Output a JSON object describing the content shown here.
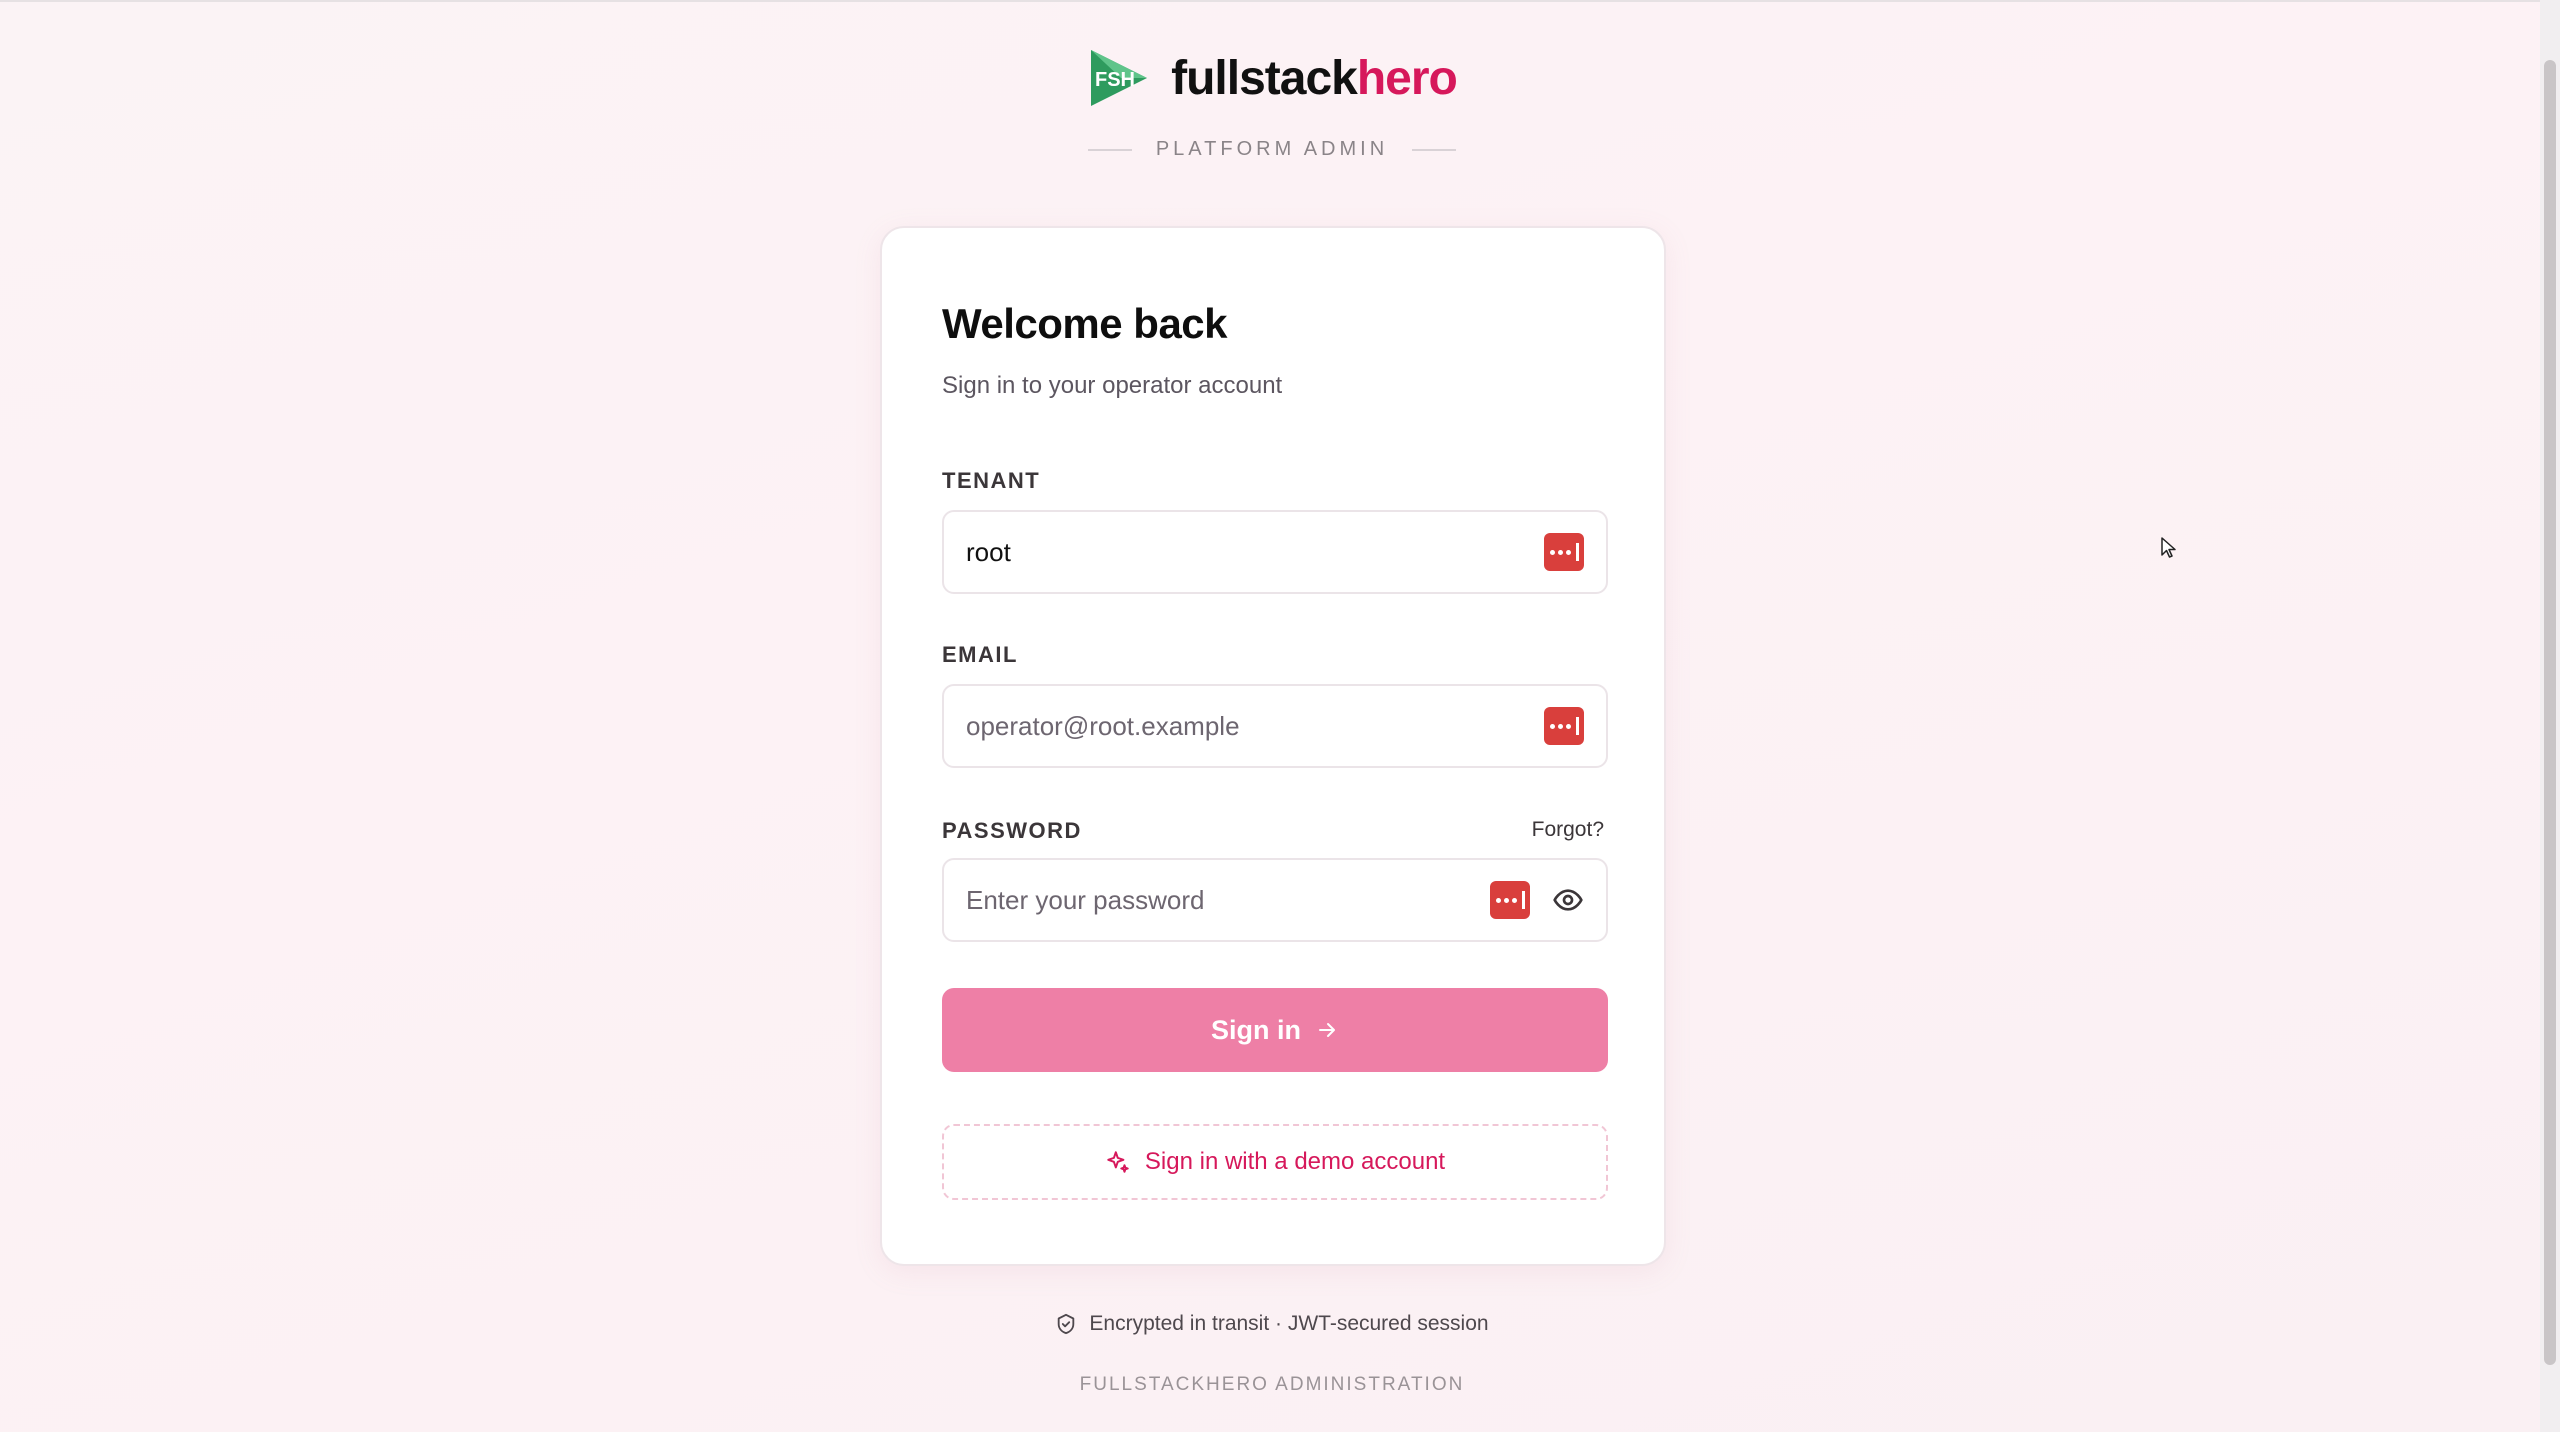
{
  "brand": {
    "logo_text": "FSH",
    "name_part1": "fullstack",
    "name_part2": "hero",
    "subtitle": "PLATFORM ADMIN"
  },
  "card": {
    "title": "Welcome back",
    "subtitle": "Sign in to your operator account"
  },
  "form": {
    "tenant": {
      "label": "TENANT",
      "value": "root",
      "placeholder": ""
    },
    "email": {
      "label": "EMAIL",
      "value": "",
      "placeholder": "operator@root.example"
    },
    "password": {
      "label": "PASSWORD",
      "value": "",
      "placeholder": "Enter your password",
      "forgot_label": "Forgot?"
    },
    "signin_label": "Sign in",
    "demo_label": "Sign in with a demo account"
  },
  "security_note": "Encrypted in transit · JWT-secured session",
  "footer": "FULLSTACKHERO ADMINISTRATION",
  "colors": {
    "brand_accent": "#d6185b",
    "primary_button": "#ee7fa6",
    "password_manager": "#d93f3c",
    "logo_green": "#2e9b5e"
  },
  "icons": {
    "logo": "fsh-play-logo-icon",
    "password_manager": "password-manager-icon",
    "show_password": "eye-icon",
    "arrow": "arrow-right-icon",
    "demo": "sparkles-icon",
    "security": "shield-check-icon",
    "cursor": "mouse-cursor-icon"
  }
}
